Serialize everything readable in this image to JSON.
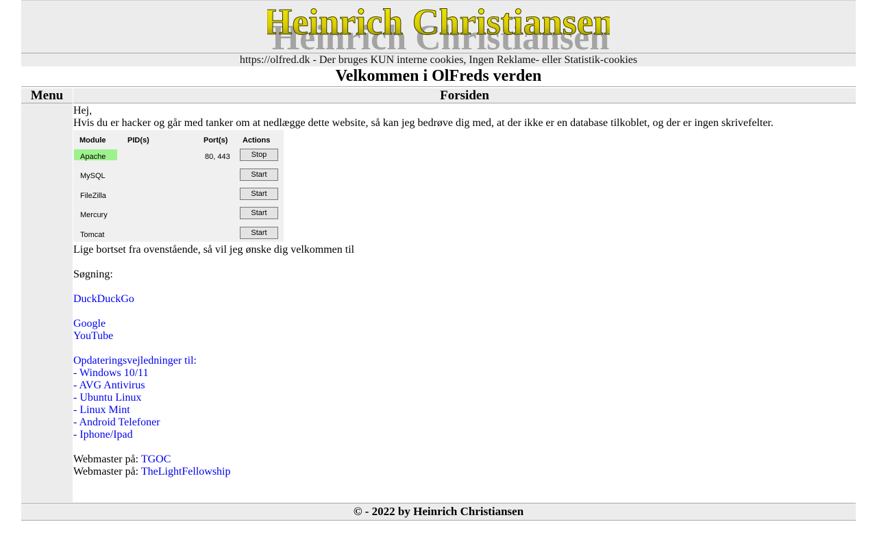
{
  "header": {
    "logo_text": "Heinrich Christiansen",
    "notice": "https://olfred.dk - Der bruges KUN interne cookies, Ingen Reklame- eller Statistik-cookies",
    "welcome": "Velkommen i OlFreds verden"
  },
  "sidebar": {
    "title": "Menu"
  },
  "content": {
    "title": "Forsiden",
    "greeting": "Hej,",
    "hacker_text": "Hvis du er hacker og går med tanker om at nedlægge dette website, så kan jeg bedrøve dig med, at der ikke er en database tilkoblet, og der er ingen skrivefelter.",
    "xampp": {
      "headers": [
        "Module",
        "PID(s)",
        "Port(s)",
        "Actions"
      ],
      "rows": [
        {
          "module": "Apache",
          "ports": "80, 443",
          "action": "Stop",
          "running": true
        },
        {
          "module": "MySQL",
          "ports": "",
          "action": "Start",
          "running": false
        },
        {
          "module": "FileZilla",
          "ports": "",
          "action": "Start",
          "running": false
        },
        {
          "module": "Mercury",
          "ports": "",
          "action": "Start",
          "running": false
        },
        {
          "module": "Tomcat",
          "ports": "",
          "action": "Start",
          "running": false
        }
      ]
    },
    "welcome_line": "Lige bortset fra ovenstående, så vil jeg ønske dig velkommen til",
    "search_label": "Søgning:",
    "links": {
      "duckduckgo": "DuckDuckGo",
      "google": "Google",
      "youtube": "YouTube",
      "updates_heading": "Opdateringsvejledninger til:",
      "windows": "- Windows 10/11",
      "avg": "- AVG Antivirus",
      "ubuntu": "- Ubuntu Linux",
      "mint": "- Linux Mint",
      "android": "- Android Telefoner",
      "iphone": "- Iphone/Ipad"
    },
    "webmaster_label": "Webmaster på:",
    "webmaster_1": "TGOC",
    "webmaster_2": "TheLightFellowship"
  },
  "footer": {
    "copyright": "© - 2022 by Heinrich Christiansen"
  },
  "colors": {
    "link": "#0000ee",
    "panel": "#ececec",
    "logo_fill": "#e8e000",
    "apache_running": "#9ef28e"
  }
}
